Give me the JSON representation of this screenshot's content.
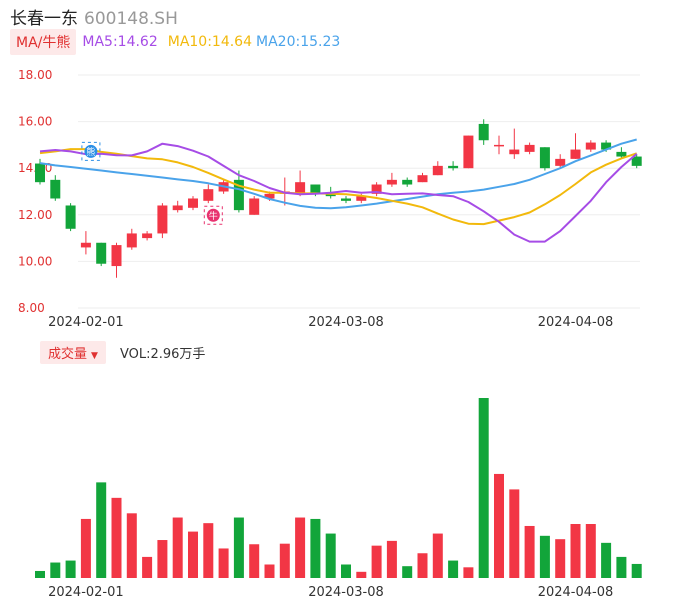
{
  "header": {
    "stock_name": "长春一东",
    "stock_code": "600148.SH"
  },
  "ma_legend": {
    "toggle_label": "MA/牛熊",
    "ma5": "MA5:14.62",
    "ma10": "MA10:14.64",
    "ma20": "MA20:15.23"
  },
  "volume_legend": {
    "toggle_label": "成交量",
    "value": "VOL:2.96万手"
  },
  "colors": {
    "up": "#f23645",
    "down": "#12a53a",
    "ma5": "#a64ce6",
    "ma10": "#f2b90c",
    "ma20": "#4aa3ea",
    "axis_text": "#e03131",
    "grid": "#eeeeee"
  },
  "markers": [
    {
      "label": "熊",
      "index": 3,
      "price": 14.72,
      "color": "#2b8fe6"
    },
    {
      "label": "牛",
      "index": 11,
      "price": 11.98,
      "color": "#e8326f"
    }
  ],
  "chart_data": {
    "type": "candlestick",
    "y_ticks": [
      "18.00",
      "16.00",
      "14.00",
      "12.00",
      "10.00",
      "8.00"
    ],
    "ylim": [
      8,
      18
    ],
    "x_labels": [
      {
        "index": 3,
        "text": "2024-02-01"
      },
      {
        "index": 20,
        "text": "2024-03-08"
      },
      {
        "index": 35,
        "text": "2024-04-08"
      }
    ],
    "candles": [
      {
        "o": 14.2,
        "c": 13.4,
        "h": 14.4,
        "l": 13.3
      },
      {
        "o": 13.5,
        "c": 12.7,
        "h": 13.7,
        "l": 12.6
      },
      {
        "o": 12.4,
        "c": 11.4,
        "h": 12.5,
        "l": 11.3
      },
      {
        "o": 10.6,
        "c": 10.8,
        "h": 11.3,
        "l": 10.3
      },
      {
        "o": 10.8,
        "c": 9.9,
        "h": 10.8,
        "l": 9.8
      },
      {
        "o": 9.8,
        "c": 10.7,
        "h": 10.8,
        "l": 9.3
      },
      {
        "o": 10.6,
        "c": 11.2,
        "h": 11.4,
        "l": 10.5
      },
      {
        "o": 11.0,
        "c": 11.2,
        "h": 11.3,
        "l": 10.9
      },
      {
        "o": 11.2,
        "c": 12.4,
        "h": 12.5,
        "l": 11.0
      },
      {
        "o": 12.2,
        "c": 12.4,
        "h": 12.6,
        "l": 12.1
      },
      {
        "o": 12.3,
        "c": 12.7,
        "h": 12.8,
        "l": 12.2
      },
      {
        "o": 12.6,
        "c": 13.1,
        "h": 13.3,
        "l": 12.5
      },
      {
        "o": 13.0,
        "c": 13.4,
        "h": 13.5,
        "l": 12.9
      },
      {
        "o": 13.5,
        "c": 12.2,
        "h": 13.9,
        "l": 12.1
      },
      {
        "o": 12.0,
        "c": 12.7,
        "h": 12.8,
        "l": 12.0
      },
      {
        "o": 12.7,
        "c": 12.9,
        "h": 13.0,
        "l": 12.6
      },
      {
        "o": 12.9,
        "c": 13.0,
        "h": 13.6,
        "l": 12.4
      },
      {
        "o": 12.9,
        "c": 13.4,
        "h": 13.9,
        "l": 12.8
      },
      {
        "o": 13.3,
        "c": 12.9,
        "h": 13.3,
        "l": 12.8
      },
      {
        "o": 12.9,
        "c": 12.8,
        "h": 13.2,
        "l": 12.7
      },
      {
        "o": 12.7,
        "c": 12.6,
        "h": 12.8,
        "l": 12.5
      },
      {
        "o": 12.6,
        "c": 12.8,
        "h": 12.9,
        "l": 12.5
      },
      {
        "o": 12.9,
        "c": 13.3,
        "h": 13.4,
        "l": 12.8
      },
      {
        "o": 13.3,
        "c": 13.5,
        "h": 13.8,
        "l": 13.2
      },
      {
        "o": 13.5,
        "c": 13.3,
        "h": 13.6,
        "l": 13.2
      },
      {
        "o": 13.4,
        "c": 13.7,
        "h": 13.8,
        "l": 13.4
      },
      {
        "o": 13.7,
        "c": 14.1,
        "h": 14.3,
        "l": 13.7
      },
      {
        "o": 14.1,
        "c": 14.0,
        "h": 14.3,
        "l": 13.9
      },
      {
        "o": 14.0,
        "c": 15.4,
        "h": 15.4,
        "l": 14.0
      },
      {
        "o": 15.9,
        "c": 15.2,
        "h": 16.1,
        "l": 15.0
      },
      {
        "o": 15.0,
        "c": 15.0,
        "h": 15.4,
        "l": 14.6
      },
      {
        "o": 14.6,
        "c": 14.8,
        "h": 15.7,
        "l": 14.4
      },
      {
        "o": 14.7,
        "c": 15.0,
        "h": 15.1,
        "l": 14.6
      },
      {
        "o": 14.9,
        "c": 14.0,
        "h": 14.9,
        "l": 13.9
      },
      {
        "o": 14.1,
        "c": 14.4,
        "h": 14.6,
        "l": 14.0
      },
      {
        "o": 14.4,
        "c": 14.8,
        "h": 15.5,
        "l": 14.4
      },
      {
        "o": 14.8,
        "c": 15.1,
        "h": 15.2,
        "l": 14.7
      },
      {
        "o": 15.1,
        "c": 14.8,
        "h": 15.2,
        "l": 14.7
      },
      {
        "o": 14.7,
        "c": 14.5,
        "h": 14.9,
        "l": 14.4
      },
      {
        "o": 14.5,
        "c": 14.1,
        "h": 14.6,
        "l": 14.0
      }
    ],
    "volumes": [
      0.25,
      0.55,
      0.62,
      2.1,
      3.4,
      2.85,
      2.3,
      0.75,
      1.35,
      2.15,
      1.65,
      1.95,
      1.05,
      2.15,
      1.2,
      0.48,
      1.22,
      2.15,
      2.1,
      1.58,
      0.48,
      0.22,
      1.15,
      1.32,
      0.42,
      0.88,
      1.58,
      0.62,
      0.38,
      6.4,
      3.7,
      3.15,
      1.85,
      1.5,
      1.38,
      1.92,
      1.92,
      1.25,
      0.75,
      0.5
    ],
    "ma5": [
      14.72,
      14.78,
      14.72,
      14.6,
      14.62,
      14.56,
      14.55,
      14.72,
      15.05,
      14.95,
      14.75,
      14.5,
      14.1,
      13.7,
      13.45,
      13.15,
      12.95,
      12.88,
      12.9,
      12.95,
      13.02,
      12.95,
      12.98,
      12.88,
      12.9,
      12.92,
      12.85,
      12.8,
      12.55,
      12.15,
      11.7,
      11.15,
      10.85,
      10.85,
      11.3,
      11.95,
      12.6,
      13.4,
      14.05,
      14.62
    ],
    "ma10": [
      14.65,
      14.72,
      14.82,
      14.82,
      14.7,
      14.62,
      14.52,
      14.42,
      14.38,
      14.25,
      14.05,
      13.8,
      13.52,
      13.25,
      13.08,
      12.95,
      12.95,
      12.92,
      12.92,
      12.9,
      12.88,
      12.82,
      12.72,
      12.6,
      12.48,
      12.32,
      12.05,
      11.8,
      11.62,
      11.6,
      11.75,
      11.9,
      12.1,
      12.45,
      12.85,
      13.32,
      13.82,
      14.15,
      14.42,
      14.64
    ],
    "ma20": [
      14.22,
      14.12,
      14.05,
      13.98,
      13.9,
      13.82,
      13.75,
      13.68,
      13.6,
      13.52,
      13.45,
      13.35,
      13.22,
      13.1,
      12.9,
      12.68,
      12.52,
      12.38,
      12.3,
      12.28,
      12.32,
      12.4,
      12.48,
      12.58,
      12.68,
      12.78,
      12.88,
      12.95,
      13.0,
      13.08,
      13.2,
      13.32,
      13.5,
      13.75,
      14.0,
      14.3,
      14.55,
      14.8,
      15.05,
      15.23
    ]
  }
}
